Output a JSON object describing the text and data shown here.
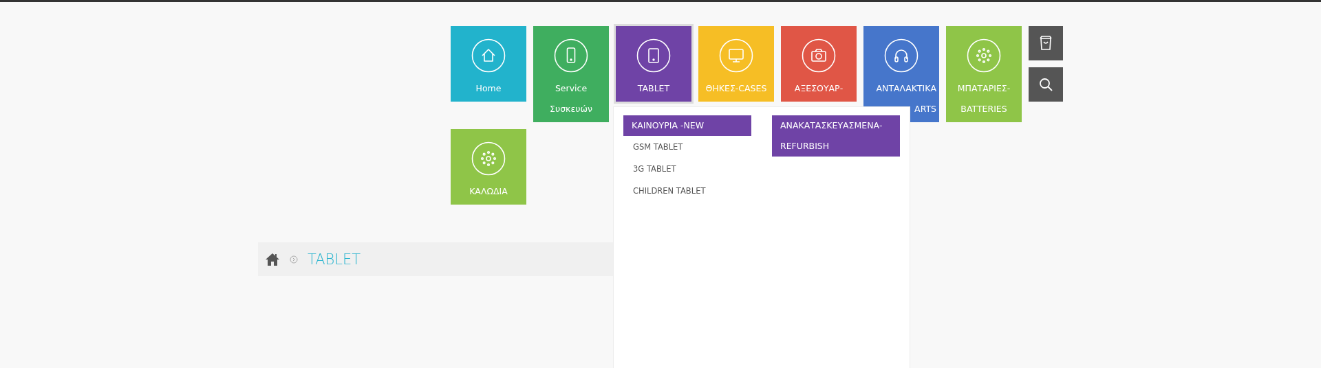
{
  "nav": {
    "tiles": [
      {
        "lines": [
          "Home"
        ],
        "color": "#22b3cc",
        "selected": false
      },
      {
        "lines": [
          "Service",
          "Συσκευών"
        ],
        "color": "#3fae5f",
        "selected": false
      },
      {
        "lines": [
          "TABLET"
        ],
        "color": "#6f43a6",
        "selected": true
      },
      {
        "lines": [
          "ΘΗΚΕΣ-CASES"
        ],
        "color": "#f6be25",
        "selected": false
      },
      {
        "lines": [
          "ΑΞΕΣΟΥΑΡ-"
        ],
        "color": "#e05646",
        "selected": false
      },
      {
        "lines": [
          "ΑΝΤΑΛΑΚΤΙΚΑ",
          "ARTS"
        ],
        "color": "#4676cb",
        "selected": false,
        "partly_covered": true
      },
      {
        "lines": [
          "ΜΠΑΤΑΡΙΕΣ-",
          "BATTERIES"
        ],
        "color": "#8fc548",
        "selected": false
      },
      {
        "lines": [
          "ΚΑΛΩΔΙΑ"
        ],
        "color": "#8fc548",
        "selected": false
      }
    ]
  },
  "dropdown": {
    "columns": [
      {
        "heading": "ΚΑΙΝΟΥΡΙΑ -NEW",
        "items": [
          "GSM TABLET",
          "3G TABLET",
          "CHILDREN TABLET"
        ]
      },
      {
        "heading": "ΑΝΑΚΑΤΑΣΚΕΥΑΣΜΕΝΑ-REFURBISH"
      }
    ]
  },
  "breadcrumb": {
    "current": "TABLET"
  }
}
